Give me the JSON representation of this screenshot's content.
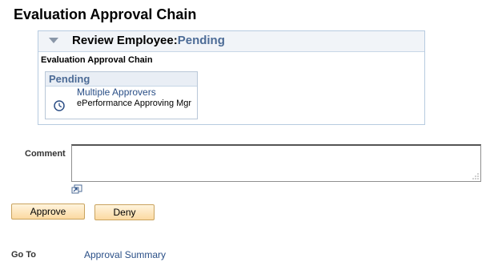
{
  "page": {
    "title": "Evaluation Approval Chain"
  },
  "review": {
    "label": "Review Employee:",
    "status": "Pending",
    "subtitle": "Evaluation Approval Chain",
    "stage": {
      "status": "Pending",
      "approver_link": "Multiple Approvers",
      "approver_role": "ePerformance Approving Mgr",
      "icon": "clock-icon"
    }
  },
  "comment": {
    "label": "Comment",
    "value": ""
  },
  "actions": {
    "approve_label": "Approve",
    "deny_label": "Deny"
  },
  "goto": {
    "label": "Go To",
    "link": "Approval Summary"
  },
  "colors": {
    "link": "#2a4f87",
    "status": "#4c6b96",
    "header_bg": "#f1f4f8",
    "border": "#b7cbe0",
    "button_bg": "#fbd9a1"
  }
}
